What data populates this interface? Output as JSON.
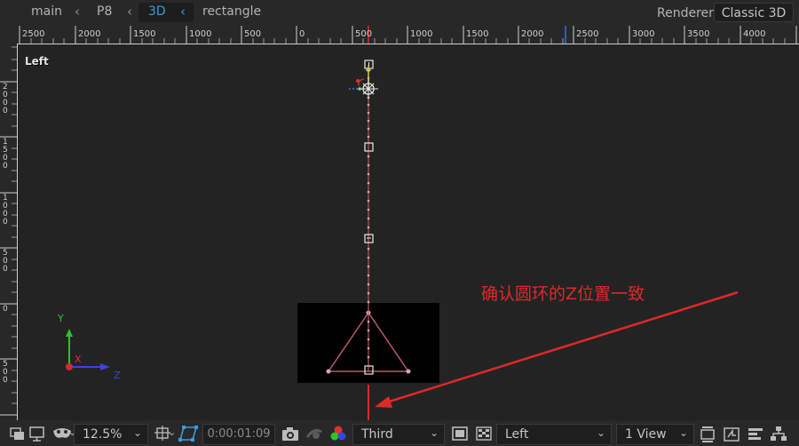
{
  "topbar": {
    "breadcrumbs": [
      {
        "label": "main"
      },
      {
        "label": "P8"
      },
      {
        "label": "3D",
        "active": true
      },
      {
        "label": "rectangle"
      }
    ],
    "renderer_label": "Renderer:",
    "renderer_value": "Classic 3D"
  },
  "viewer": {
    "view_label": "Left",
    "hruler_ticks": [
      "2500",
      "2000",
      "1500",
      "1000",
      "500",
      "0",
      "500",
      "1000",
      "1500",
      "2000",
      "2500",
      "3000",
      "3500",
      "4000"
    ],
    "vruler_ticks": [
      "2000",
      "1500",
      "1000",
      "500",
      "0",
      "500"
    ],
    "axis_labels": {
      "x": "X",
      "y": "Y",
      "z": "Z"
    },
    "annotation": "确认圆环的Z位置一致",
    "colors": {
      "annotation": "#e02828",
      "path": "#d9a7b0",
      "accent": "#3a9be0"
    }
  },
  "bottombar": {
    "zoom": "12.5%",
    "timecode": "0:00:01:09",
    "camera": "Third",
    "view": "Left",
    "layout": "1 View",
    "icons": [
      "preview-icon",
      "monitor-icon",
      "mask-icon",
      "region-icon",
      "transparency-grid-icon",
      "snapshot-icon",
      "show-snapshot-icon",
      "color-channels-icon",
      "fast-preview-icon",
      "checkerboard-icon",
      "reset-exposure-icon",
      "timeline-icon",
      "flowchart-icon"
    ]
  }
}
